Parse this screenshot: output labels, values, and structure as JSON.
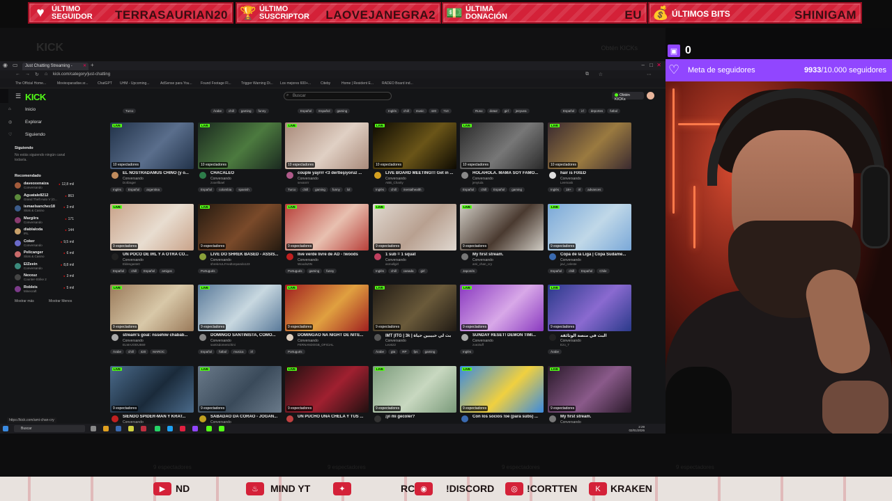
{
  "alerts": [
    {
      "label": "Último seguidor",
      "value": "TERRASAURIAN20",
      "icon": "heart-icon"
    },
    {
      "label": "Último suscriptor",
      "value": "LAOVEJANEGRA2",
      "icon": "trophy-icon"
    },
    {
      "label": "Última donación",
      "value": "EU",
      "icon": "money-icon"
    },
    {
      "label": "Últimos bits",
      "value": "SHINIGAM",
      "icon": "money-bag-icon"
    }
  ],
  "background": {
    "logo": "KICK",
    "right_text": "Obtén KICKs"
  },
  "browser": {
    "tab_title": "Just Chatting Streaming -",
    "url": "kick.com/category/just-chatting",
    "bookmarks": [
      "The Official Home...",
      "Moviesparadise.sr...",
      "ChatGPT",
      "UHM - Upcoming...",
      "AdSense para You...",
      "Found Footage Fl...",
      "Trigger Warning Di...",
      "Los mejores 600+...",
      "Citeby",
      "Home | Resident E...",
      "RADEO Board ind..."
    ]
  },
  "kick": {
    "logo": "KICK",
    "search_placeholder": "Buscar",
    "get_kicks": "Obtén KICKs",
    "nav": [
      {
        "label": "Inicio",
        "icon": "home-icon"
      },
      {
        "label": "Explorar",
        "icon": "compass-icon"
      },
      {
        "label": "Siguiendo",
        "icon": "heart-icon"
      }
    ],
    "following_heading": "Siguiendo",
    "following_note": "No estás siguiendo ningún canal todavía.",
    "recommended_heading": "Recomendado",
    "recommended": [
      {
        "name": "daveoxenaiza",
        "cat": "Conversando",
        "viewers": "12,8 mil",
        "color": "#a35b3b"
      },
      {
        "name": "Aguatale8212",
        "cat": "Grand Theft Auto V (G...",
        "viewers": "863",
        "color": "#5b8a3b"
      },
      {
        "name": "ismaelsanchez18",
        "cat": "Slots & Casino",
        "viewers": "3 mil",
        "color": "#3b5b8a"
      },
      {
        "name": "Margiirs",
        "cat": "Conversando",
        "viewers": "171",
        "color": "#8a3b6f"
      },
      {
        "name": "diablaloda",
        "cat": "IRL",
        "viewers": "144",
        "color": "#c9a16a"
      },
      {
        "name": "Coker",
        "cat": "Conversando",
        "viewers": "9,5 mil",
        "color": "#6a6ac9"
      },
      {
        "name": "Pelicanger",
        "cat": "Slots & Casino",
        "viewers": "6 mil",
        "color": "#c96a6a"
      },
      {
        "name": "ElZeein",
        "cat": "Conversando",
        "viewers": "8,8 mil",
        "color": "#3b8a7c"
      },
      {
        "name": "Nexxuz",
        "cat": "Counter-Strike 2",
        "viewers": "3 mil",
        "color": "#444444"
      },
      {
        "name": "Robleis",
        "cat": "Minecraft",
        "viewers": "5 mil",
        "color": "#7c3b8a"
      }
    ],
    "show_more": "Mostrar más",
    "show_less": "Mostrar Menos",
    "top_tags": [
      [
        "Turco"
      ],
      [
        "Árabe",
        "chill",
        "gaming",
        "funny"
      ],
      [
        "Español",
        "Español",
        "gaming"
      ],
      [
        "Inglés",
        "chill",
        "music",
        "420",
        "710"
      ],
      [
        "Ruso",
        "dota2",
        "girl",
        "jeeyuea"
      ],
      [
        "Español",
        "irl",
        "deportes",
        "futbol"
      ]
    ],
    "streams": [
      {
        "title": "EL NOSTRADAMUS CHINO (y o...",
        "cat": "Conversando",
        "channel": "DolDager",
        "viewers": "10 espectadores",
        "tags": [
          "Inglés",
          "Español",
          "argentina"
        ],
        "colors": [
          "#22334a",
          "#5a6e8c"
        ],
        "av": "#c08b5c"
      },
      {
        "title": "CHACALEO",
        "cat": "Conversando",
        "channel": "zooellbael",
        "viewers": "10 espectadores",
        "tags": [
          "Español",
          "colombia",
          "spanish"
        ],
        "colors": [
          "#1b2a20",
          "#4c7a3f"
        ],
        "av": "#2d7c4a"
      },
      {
        "title": "couple yayrrr <3 dertleşiyoruz ...",
        "cat": "Conversando",
        "channel": "sevanrrr",
        "viewers": "10 espectadores",
        "tags": [
          "Turco",
          "chill",
          "gaming",
          "funny",
          "lol"
        ],
        "colors": [
          "#a98a7a",
          "#e0d0c4"
        ],
        "av": "#b05a8a"
      },
      {
        "title": "LIVE BOARD MEETING!!! Get in ...",
        "cat": "Conversando",
        "channel": "ABB_Charity",
        "viewers": "10 espectadores",
        "tags": [
          "Inglés",
          "chill",
          "mentalhealth"
        ],
        "colors": [
          "#0d0a02",
          "#6a5518"
        ],
        "av": "#d4a020"
      },
      {
        "title": "HOLAHOLA. MAMÁ SOY FAMO...",
        "cat": "Conversando",
        "channel": "jenytula",
        "viewers": "10 espectadores",
        "tags": [
          "Español",
          "chill",
          "Español",
          "gaming"
        ],
        "colors": [
          "#2a2a2a",
          "#777"
        ],
        "av": "#888"
      },
      {
        "title": "hair is FIXED",
        "cat": "Conversando",
        "channel": "Leemask",
        "viewers": "10 espectadores",
        "tags": [
          "Inglés",
          "18+",
          "irl",
          "advances"
        ],
        "colors": [
          "#3a2a30",
          "#9a7a40"
        ],
        "av": "#ddd"
      },
      {
        "title": "UN POCO DE IRL Y A OTRA CO...",
        "cat": "Conversando",
        "channel": "Eldesgaste0",
        "viewers": "9 espectadores",
        "tags": [
          "Español",
          "chill",
          "Español",
          "amigos"
        ],
        "colors": [
          "#c9a38a",
          "#e8ddd0"
        ],
        "av": "#222"
      },
      {
        "title": "LIVE DO SHREK BASED - ASSIS...",
        "cat": "Conversando",
        "channel": "shrekAULFAedtonpando123",
        "viewers": "9 espectadores",
        "tags": [
          "Portugués"
        ],
        "colors": [
          "#251a10",
          "#7a4a2a"
        ],
        "av": "#8aa03a"
      },
      {
        "title": "live verde livre de AD - !woods",
        "cat": "Conversando",
        "channel": "WoodsZIN",
        "viewers": "9 espectadores",
        "tags": [
          "Portugués",
          "gaming",
          "funny"
        ],
        "colors": [
          "#b8403a",
          "#e8c0b0"
        ],
        "av": "#c02020"
      },
      {
        "title": "1 sub = 1 squat",
        "cat": "Conversando",
        "channel": "asmallgirl",
        "viewers": "9 espectadores",
        "tags": [
          "Inglés",
          "chill",
          "canada",
          "girl"
        ],
        "colors": [
          "#e0d8d0",
          "#b8a090"
        ],
        "av": "#c04060"
      },
      {
        "title": "My first stream.",
        "cat": "Conversando",
        "channel": "ami_chan_cry",
        "viewers": "9 espectadores",
        "tags": [
          "Japonés"
        ],
        "colors": [
          "#d0ccc4",
          "#4a3a30"
        ],
        "av": "#777"
      },
      {
        "title": "Copa de la Liga | Copa Sudame...",
        "cat": "Conversando",
        "channel": "javi_celeste",
        "viewers": "9 espectadores",
        "tags": [
          "Español",
          "chill",
          "Español",
          "Chile"
        ],
        "colors": [
          "#7aa8d8",
          "#c0d8e8"
        ],
        "av": "#3a6ab0"
      },
      {
        "title": "stream's goal: nssehiw chabab...",
        "cat": "Conversando",
        "channel": "ELMAJODUB69",
        "viewers": "9 espectadores",
        "tags": [
          "Árabe",
          "chill",
          "420",
          "MAROC"
        ],
        "colors": [
          "#9a7a5a",
          "#d8c8a8"
        ],
        "av": "#aaa"
      },
      {
        "title": "DOMINGO SANTINISTA, COMO...",
        "cat": "Conversando",
        "channel": "santisdomenichini",
        "viewers": "9 espectadores",
        "tags": [
          "Español",
          "futbol",
          "musica",
          "irl"
        ],
        "colors": [
          "#5a7a9a",
          "#c8d8e0"
        ],
        "av": "#888"
      },
      {
        "title": "DOMINGÃO NA NIGHT DE NITE...",
        "cat": "Conversando",
        "channel": "FERNANDOGB_OFICIAL",
        "viewers": "9 espectadores",
        "tags": [
          "Portugués"
        ],
        "colors": [
          "#a02020",
          "#e0a040"
        ],
        "av": "#e0d0c0"
      },
      {
        "title": "IMT |ITG | 3k | بث لي حبيبين حياة",
        "cat": "Conversando",
        "channel": "Leo622",
        "viewers": "9 espectadores",
        "tags": [
          "Árabe",
          "gta",
          "RP",
          "fps",
          "gaming"
        ],
        "colors": [
          "#201a14",
          "#6a5a3a"
        ],
        "av": "#555"
      },
      {
        "title": "SUNDAY RESET! DEMON TIMI...",
        "cat": "Conversando",
        "channel": "zoe2tuff",
        "viewers": "9 espectadores",
        "tags": [
          "Inglés"
        ],
        "colors": [
          "#8a3ac0",
          "#d8a8e8"
        ],
        "av": "#aaa"
      },
      {
        "title": "البث في منصة الوثائقة",
        "cat": "Conversando",
        "channel": "Ezo_7",
        "viewers": "9 espectadores",
        "tags": [
          "Árabe"
        ],
        "colors": [
          "#2a3a8a",
          "#8a6ad0"
        ],
        "av": "#222"
      },
      {
        "title": "SIENDO SPIDER-MAN Y KRAT...",
        "cat": "Conversando",
        "channel": "",
        "viewers": "9 espectadores",
        "tags": [],
        "colors": [
          "#4a6a8a",
          "#1a2a3a"
        ],
        "av": "#c02020"
      },
      {
        "title": "SABADÃO DA CORÃO - JOGAN...",
        "cat": "Conversando",
        "channel": "",
        "viewers": "9 espectadores",
        "tags": [],
        "colors": [
          "#6a7a8a",
          "#3a4a5a"
        ],
        "av": "#c0a020"
      },
      {
        "title": "UN PUCHO UNA CHELA Y TUS ...",
        "cat": "",
        "channel": "",
        "viewers": "9 espectadores",
        "tags": [],
        "colors": [
          "#201010",
          "#a02030"
        ],
        "av": "#c04040"
      },
      {
        "title": "¡yi mi gecoler?",
        "cat": "",
        "channel": "",
        "viewers": "9 espectadores",
        "tags": [],
        "colors": [
          "#7a9a7a",
          "#c8d8c0"
        ],
        "av": "#333"
      },
      {
        "title": "Con los socios !oe (para subs) ...",
        "cat": "",
        "channel": "",
        "viewers": "9 espectadores",
        "tags": [],
        "colors": [
          "#3a8ae0",
          "#f0d040"
        ],
        "av": "#3a6ab0"
      },
      {
        "title": "My first stream.",
        "cat": "Conversando",
        "channel": "",
        "viewers": "9 espectadores",
        "tags": [],
        "colors": [
          "#2a1a2a",
          "#8a5a8a"
        ],
        "av": "#777"
      }
    ],
    "status_url": "https://kick.com/ami-chan-cry",
    "taskbar_search": "Buscar",
    "clock_time": "2:29",
    "clock_date": "02/01/2026"
  },
  "webcam": {
    "twitch_count": "0",
    "goal_label": "Meta de seguidores",
    "goal_current": "9933",
    "goal_total": "/10.000 seguidores",
    "goal_progress": 0.9933
  },
  "bottom_ghost": "9 espectadores",
  "social": [
    {
      "icon": "youtube-icon",
      "label": "ND"
    },
    {
      "icon": "steam-icon",
      "label": "MIND YT"
    },
    {
      "icon": "twitter-icon",
      "label": "RC"
    },
    {
      "icon": "discord-icon",
      "label": "!DISCORD"
    },
    {
      "icon": "instagram-icon",
      "label": "!CORTTEN"
    },
    {
      "icon": "kraken-icon",
      "label": "KRAKEN"
    }
  ]
}
